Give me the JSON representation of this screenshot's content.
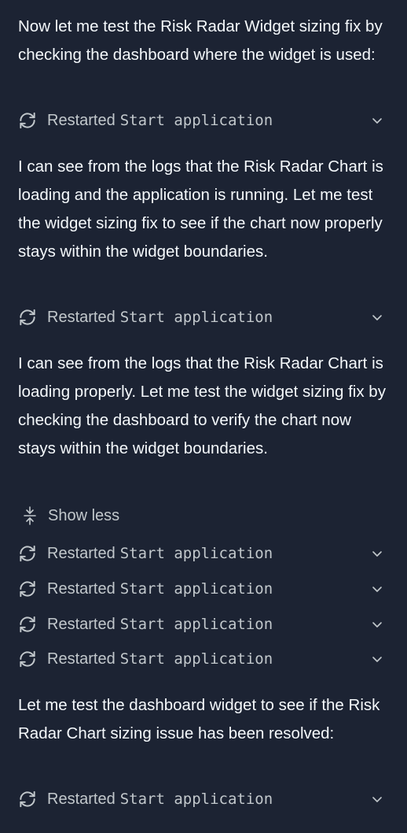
{
  "messages": [
    "Now let me test the Risk Radar Widget sizing fix by checking the dashboard where the widget is used:",
    "I can see from the logs that the Risk Radar Chart is loading and the application is running. Let me test the widget sizing fix to see if the chart now properly stays within the widget boundaries.",
    "I can see from the logs that the Risk Radar Chart is loading properly. Let me test the widget sizing fix by checking the dashboard to verify the chart now stays within the widget boundaries.",
    "Let me test the dashboard widget to see if the Risk Radar Chart sizing issue has been resolved:"
  ],
  "actions": [
    {
      "label": "Restarted",
      "command": "Start application",
      "icon": "restart-icon"
    },
    {
      "label": "Restarted",
      "command": "Start application",
      "icon": "restart-icon"
    },
    {
      "label": "Restarted",
      "command": "Start application",
      "icon": "restart-icon"
    },
    {
      "label": "Restarted",
      "command": "Start application",
      "icon": "restart-icon"
    },
    {
      "label": "Restarted",
      "command": "Start application",
      "icon": "restart-icon"
    },
    {
      "label": "Restarted",
      "command": "Start application",
      "icon": "restart-icon"
    },
    {
      "label": "Restarted",
      "command": "Start application",
      "icon": "restart-icon"
    }
  ],
  "show_less": {
    "label": "Show less",
    "icon": "collapse-icon"
  },
  "colors": {
    "background": "#1c2333",
    "text": "#f5f9fc",
    "muted": "#c2c8cc"
  }
}
